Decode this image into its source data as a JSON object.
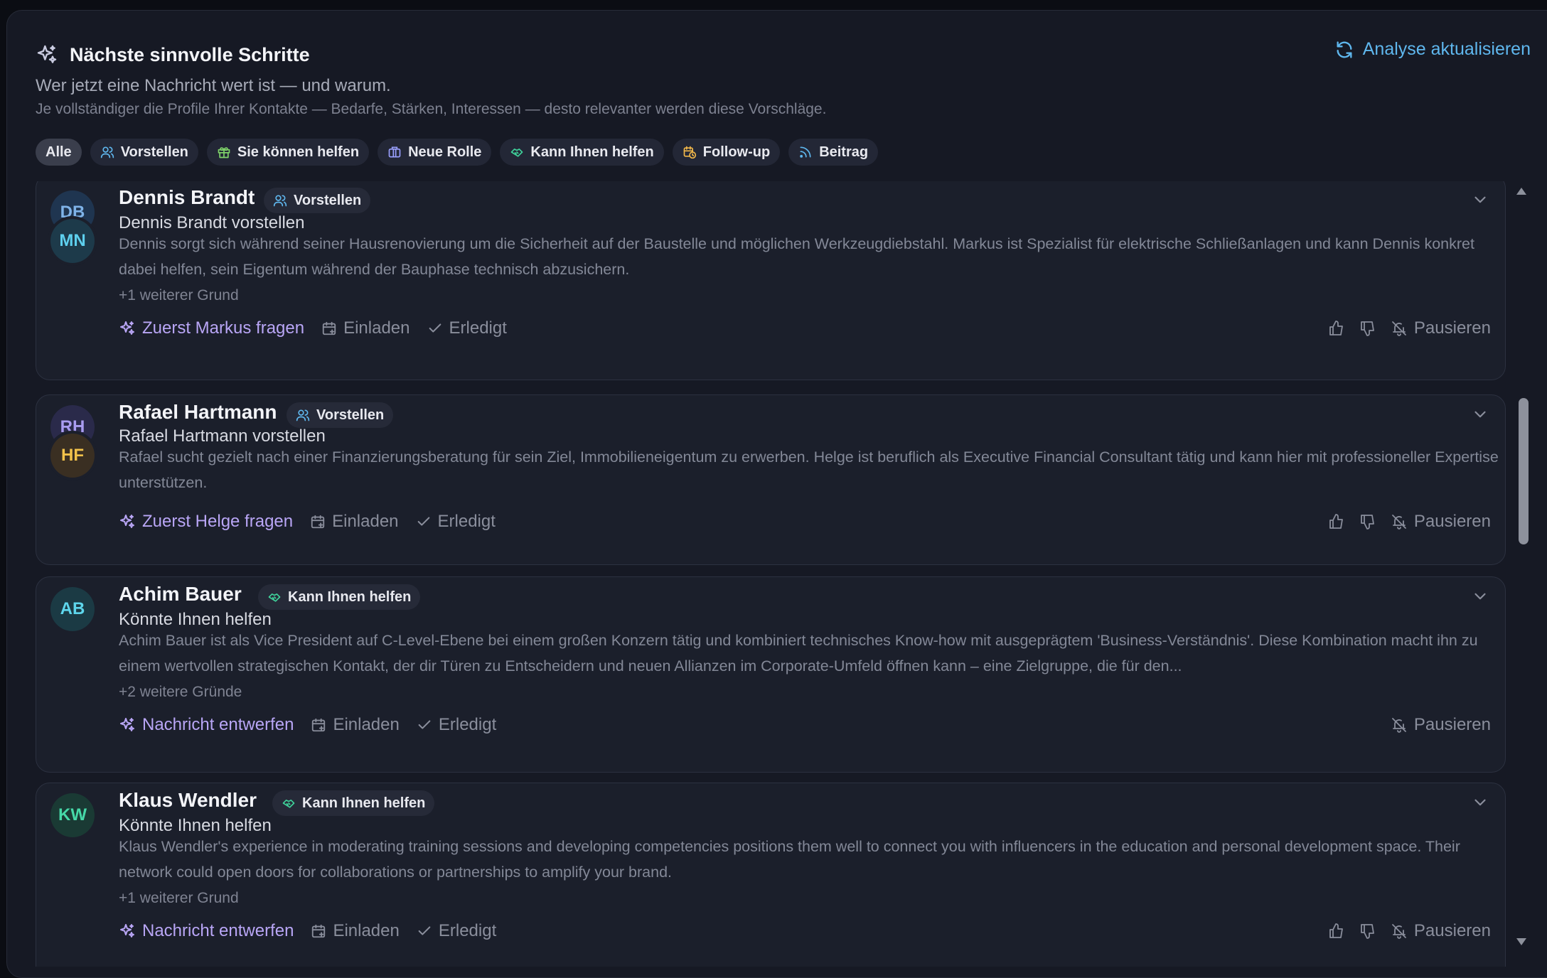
{
  "header": {
    "title": "Nächste sinnvolle Schritte",
    "refresh_label": "Analyse aktualisieren",
    "subtitle": "Wer jetzt eine Nachricht wert ist — und warum.",
    "hint": "Je vollständiger die Profile Ihrer Kontakte — Bedarfe, Stärken, Interessen — desto relevanter werden diese Vorschläge."
  },
  "filters": [
    {
      "label": "Alle",
      "icon": "none",
      "active": true
    },
    {
      "label": "Vorstellen",
      "icon": "users-icon",
      "color": "#5fb7ee"
    },
    {
      "label": "Sie können helfen",
      "icon": "gift-icon",
      "color": "#7fd36a"
    },
    {
      "label": "Neue Rolle",
      "icon": "briefcase-icon",
      "color": "#9aa0ff"
    },
    {
      "label": "Kann Ihnen helfen",
      "icon": "handshake-icon",
      "color": "#3fd19a"
    },
    {
      "label": "Follow-up",
      "icon": "calendar-clock-icon",
      "color": "#f2b84a"
    },
    {
      "label": "Beitrag",
      "icon": "rss-icon",
      "color": "#5fb7ee"
    }
  ],
  "cards": [
    {
      "avatars": [
        {
          "initials": "DB",
          "bg": "#1f3550",
          "fg": "#7fb3e8"
        },
        {
          "initials": "MN",
          "bg": "#1d3a4a",
          "fg": "#5ed0ee"
        }
      ],
      "name": "Dennis Brandt",
      "tag": {
        "label": "Vorstellen",
        "icon": "users-icon",
        "color": "#5fb7ee"
      },
      "subtitle": "Dennis Brandt vorstellen",
      "description": "Dennis sorgt sich während seiner Hausrenovierung um die Sicherheit auf der Baustelle und möglichen Werkzeugdiebstahl. Markus ist Spezialist für elektrische Schließanlagen und kann Dennis konkret dabei helfen, sein Eigentum während der Bauphase technisch abzusichern.",
      "more": "+1 weiterer Grund",
      "primary_action": "Zuerst Markus fragen",
      "invite": "Einladen",
      "done": "Erledigt",
      "pause": "Pausieren",
      "thumbs": true
    },
    {
      "avatars": [
        {
          "initials": "RH",
          "bg": "#2a2a4a",
          "fg": "#a99cf0"
        },
        {
          "initials": "HF",
          "bg": "#3a2f22",
          "fg": "#f2c24a"
        }
      ],
      "name": "Rafael Hartmann",
      "tag": {
        "label": "Vorstellen",
        "icon": "users-icon",
        "color": "#5fb7ee"
      },
      "subtitle": "Rafael Hartmann vorstellen",
      "description": "Rafael sucht gezielt nach einer Finanzierungsberatung für sein Ziel, Immobilieneigentum zu erwerben. Helge ist beruflich als Executive Financial Consultant tätig und kann hier mit professioneller Expertise unterstützen.",
      "more": "",
      "primary_action": "Zuerst Helge fragen",
      "invite": "Einladen",
      "done": "Erledigt",
      "pause": "Pausieren",
      "thumbs": true
    },
    {
      "avatars": [
        {
          "initials": "AB",
          "bg": "#1b3a44",
          "fg": "#5ed6ec"
        }
      ],
      "name": "Achim Bauer",
      "tag": {
        "label": "Kann Ihnen helfen",
        "icon": "handshake-icon",
        "color": "#3fd19a"
      },
      "subtitle": "Könnte Ihnen helfen",
      "description": "Achim Bauer ist als Vice President auf C-Level-Ebene bei einem großen Konzern tätig und kombiniert technisches Know-how mit ausgeprägtem 'Business-Verständnis'. Diese Kombination macht ihn zu einem wertvollen strategischen Kontakt, der dir Türen zu Entscheidern und neuen Allianzen im Corporate-Umfeld öffnen kann – eine Zielgruppe, die für den...",
      "more": "+2 weitere Gründe",
      "primary_action": "Nachricht entwerfen",
      "invite": "Einladen",
      "done": "Erledigt",
      "pause": "Pausieren",
      "thumbs": false
    },
    {
      "avatars": [
        {
          "initials": "KW",
          "bg": "#1a3a34",
          "fg": "#46d8a8"
        }
      ],
      "name": "Klaus Wendler",
      "tag": {
        "label": "Kann Ihnen helfen",
        "icon": "handshake-icon",
        "color": "#3fd19a"
      },
      "subtitle": "Könnte Ihnen helfen",
      "description": "Klaus Wendler's experience in moderating training sessions and developing competencies positions them well to connect you with influencers in the education and personal development space. Their network could open doors for collaborations or partnerships to amplify your brand.",
      "more": "+1 weiterer Grund",
      "primary_action": "Nachricht entwerfen",
      "invite": "Einladen",
      "done": "Erledigt",
      "pause": "Pausieren",
      "thumbs": true
    }
  ]
}
